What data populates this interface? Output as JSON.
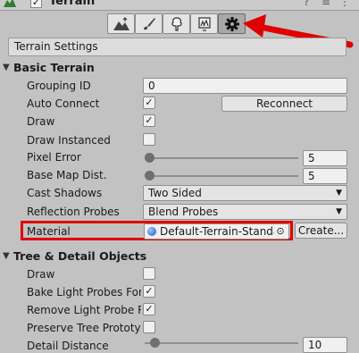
{
  "component": {
    "title": "Terrain",
    "enabled_mark": "✓",
    "icons": [
      "terrain-icon",
      "help-icon",
      "preset-icon",
      "more-icon"
    ]
  },
  "toolbar": {
    "buttons": [
      {
        "name": "raise-lower-terrain-icon",
        "selected": false
      },
      {
        "name": "paint-brush-icon",
        "selected": false
      },
      {
        "name": "paint-trees-icon",
        "selected": false
      },
      {
        "name": "paint-details-icon",
        "selected": false
      },
      {
        "name": "gear-icon",
        "selected": true
      }
    ]
  },
  "settings_title": "Terrain Settings",
  "basic": {
    "header": "Basic Terrain",
    "grouping_id": {
      "label": "Grouping ID",
      "value": "0"
    },
    "auto_connect": {
      "label": "Auto Connect",
      "checked": true,
      "mark": "✓",
      "button": "Reconnect"
    },
    "draw": {
      "label": "Draw",
      "checked": true,
      "mark": "✓"
    },
    "draw_instanced": {
      "label": "Draw Instanced",
      "checked": false
    },
    "pixel_error": {
      "label": "Pixel Error",
      "value": "5",
      "fraction": 0.0
    },
    "base_map_dist": {
      "label": "Base Map Dist.",
      "value": "5",
      "fraction": 0.0
    },
    "cast_shadows": {
      "label": "Cast Shadows",
      "value": "Two Sided"
    },
    "reflection_probes": {
      "label": "Reflection Probes",
      "value": "Blend Probes"
    },
    "material": {
      "label": "Material",
      "value": "Default-Terrain-Standa",
      "button": "Create..."
    }
  },
  "tree": {
    "header": "Tree & Detail Objects",
    "draw": {
      "label": "Draw",
      "checked": false
    },
    "bake_light_probes": {
      "label": "Bake Light Probes For T",
      "checked": true,
      "mark": "✓"
    },
    "remove_light_probe": {
      "label": "Remove Light Probe Ri",
      "checked": true,
      "mark": "✓"
    },
    "preserve_tree": {
      "label": "Preserve Tree Prototyp",
      "checked": false
    },
    "detail_distance": {
      "label": "Detail Distance",
      "value": "10"
    }
  },
  "dropdown_arrow": "▼",
  "foldout_icon": "▼",
  "colors": {
    "highlight": "#e00000",
    "panel": "#c2c2c2"
  }
}
